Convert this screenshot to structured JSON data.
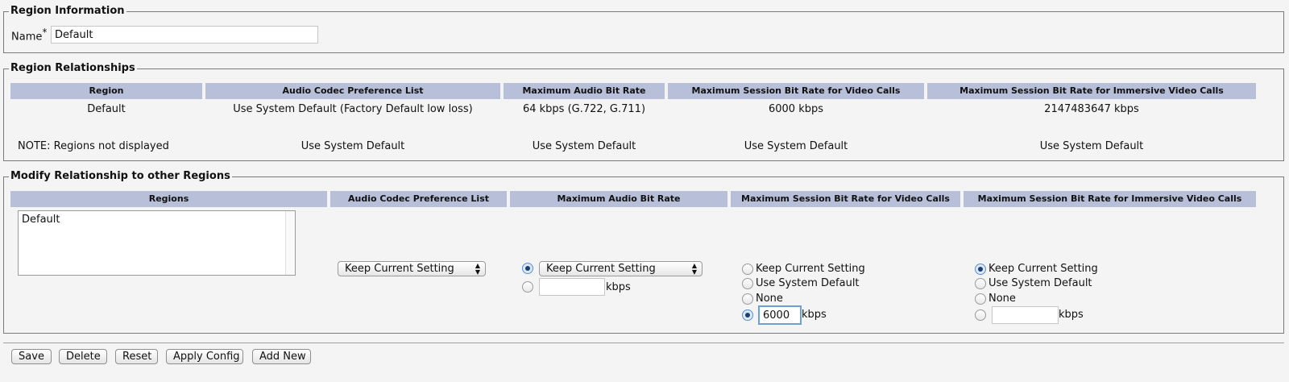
{
  "region_info": {
    "legend": "Region Information",
    "name_label": "Name",
    "required_mark": "*",
    "name_value": "Default"
  },
  "relationships": {
    "legend": "Region Relationships",
    "headers": [
      "Region",
      "Audio Codec Preference List",
      "Maximum Audio Bit Rate",
      "Maximum Session Bit Rate for Video Calls",
      "Maximum Session Bit Rate for Immersive Video Calls"
    ],
    "rows": [
      [
        "Default",
        "Use System Default (Factory Default low loss)",
        "64 kbps (G.722, G.711)",
        "6000 kbps",
        "2147483647 kbps"
      ],
      [
        "NOTE: Regions not displayed",
        "Use System Default",
        "Use System Default",
        "Use System Default",
        "Use System Default"
      ]
    ]
  },
  "modify": {
    "legend": "Modify Relationship to other Regions",
    "headers": [
      "Regions",
      "Audio Codec Preference List",
      "Maximum Audio Bit Rate",
      "Maximum Session Bit Rate for Video Calls",
      "Maximum Session Bit Rate for Immersive Video Calls"
    ],
    "regions_list": [
      "Default"
    ],
    "codec_select": "Keep Current Setting",
    "audio": {
      "select": "Keep Current Setting",
      "custom_value": "",
      "unit": "kbps",
      "selected": "keep"
    },
    "video": {
      "options": [
        "Keep Current Setting",
        "Use System Default",
        "None"
      ],
      "custom_value": "6000",
      "unit": "kbps",
      "selected": "custom"
    },
    "immersive": {
      "options": [
        "Keep Current Setting",
        "Use System Default",
        "None"
      ],
      "custom_value": "",
      "unit": "kbps",
      "selected": "Keep Current Setting"
    }
  },
  "buttons": [
    "Save",
    "Delete",
    "Reset",
    "Apply Config",
    "Add New"
  ]
}
